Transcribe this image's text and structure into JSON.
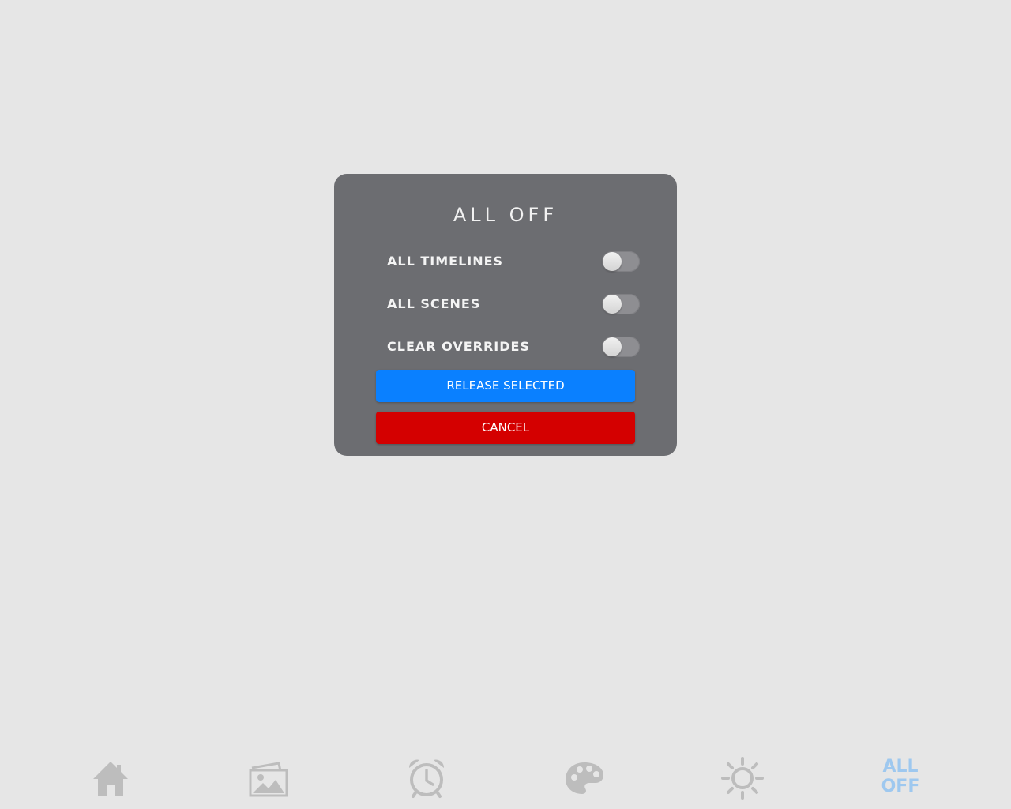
{
  "dialog": {
    "title": "ALL OFF",
    "options": [
      {
        "label": "ALL TIMELINES",
        "enabled": false
      },
      {
        "label": "ALL SCENES",
        "enabled": false
      },
      {
        "label": "CLEAR OVERRIDES",
        "enabled": false
      }
    ],
    "release_button": "RELEASE SELECTED",
    "cancel_button": "CANCEL"
  },
  "nav": {
    "items": [
      {
        "icon": "home-icon"
      },
      {
        "icon": "image-gallery-icon"
      },
      {
        "icon": "alarm-clock-icon"
      },
      {
        "icon": "palette-icon"
      },
      {
        "icon": "sun-icon"
      }
    ],
    "alloff_line1": "ALL",
    "alloff_line2": "OFF",
    "colors": {
      "inactive": "#bdbdbd",
      "active": "#9ec8ef"
    }
  },
  "colors": {
    "background": "#e6e6e6",
    "dialog": "#6c6d71",
    "release": "#0a80ff",
    "cancel": "#d40000"
  }
}
